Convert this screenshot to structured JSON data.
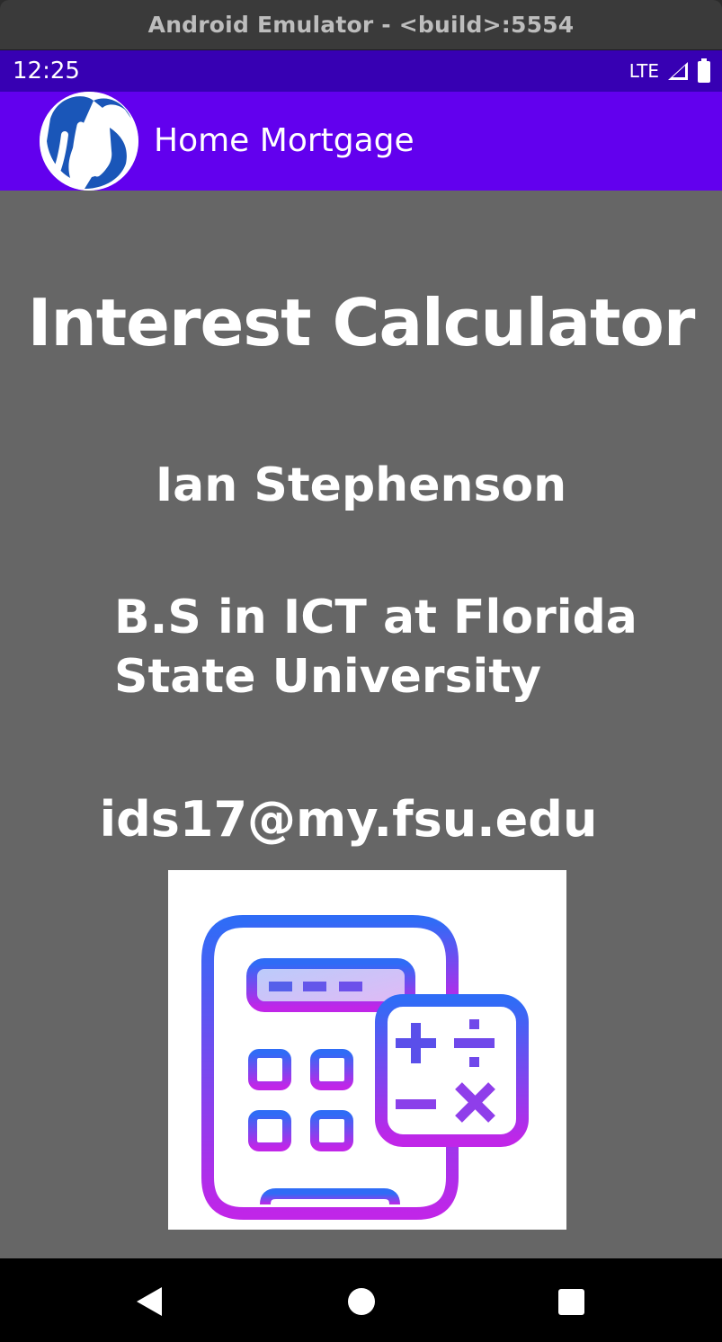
{
  "window": {
    "title": "Android Emulator - <build>:5554"
  },
  "status_bar": {
    "time": "12:25",
    "network": "LTE",
    "icons": [
      "signal-icon",
      "battery-icon"
    ]
  },
  "app_bar": {
    "title": "Home Mortgage",
    "logo": "js-logo-icon"
  },
  "main": {
    "heading": "Interest Calculator",
    "name": "Ian Stephenson",
    "degree_line1": "B.S in ICT at Florida",
    "degree_line2": "State University",
    "email": "ids17@my.fsu.edu",
    "image": "calculator-icon"
  },
  "nav_bar": {
    "buttons": [
      "back-icon",
      "home-icon",
      "recents-icon"
    ]
  },
  "colors": {
    "status_bar": "#3700b3",
    "app_bar": "#6200ee",
    "content_bg": "#666666",
    "gradient_start": "#2f6cf6",
    "gradient_end": "#c026e8"
  }
}
